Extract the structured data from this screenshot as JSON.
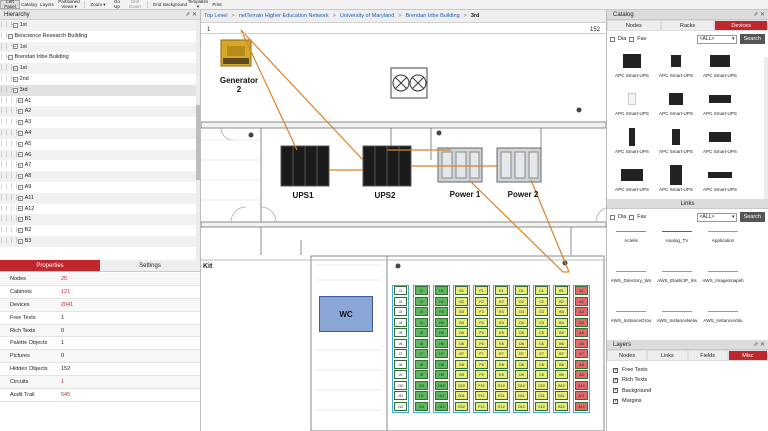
{
  "toolbar": {
    "items": [
      {
        "label": "Left Panel",
        "active": true
      },
      {
        "label": "Catalog"
      },
      {
        "label": "Layers"
      },
      {
        "label": "Partitioned Views ▾"
      },
      {
        "label": "Zoom ▾"
      },
      {
        "label": "Go Up"
      },
      {
        "label": "Drill Down",
        "disabled": true
      },
      {
        "label": "Grid"
      },
      {
        "label": "Background"
      },
      {
        "label": "Templates ▾"
      },
      {
        "label": "Print"
      }
    ]
  },
  "hierarchy": {
    "title": "Hierarchy",
    "rows": [
      {
        "guides": "│ │ ├",
        "toggle": "−",
        "label": "1st"
      },
      {
        "guides": "│ ├",
        "toggle": "−",
        "label": "Bioscience Research Building"
      },
      {
        "guides": "│ │ └",
        "toggle": "+",
        "label": "1st"
      },
      {
        "guides": "│ ├",
        "toggle": "−",
        "label": "Brendan Iribe Building"
      },
      {
        "guides": "│ │ ├",
        "toggle": "+",
        "label": "1st"
      },
      {
        "guides": "│ │ ├",
        "toggle": "+",
        "label": "2nd"
      },
      {
        "guides": "│ │ ├",
        "toggle": "−",
        "label": "3rd",
        "selected": true
      },
      {
        "guides": "│ │ │ ├",
        "toggle": "+",
        "label": "A1"
      },
      {
        "guides": "│ │ │ ├",
        "toggle": "+",
        "label": "A2"
      },
      {
        "guides": "│ │ │ ├",
        "toggle": "+",
        "label": "A3"
      },
      {
        "guides": "│ │ │ ├",
        "toggle": "+",
        "label": "A4"
      },
      {
        "guides": "│ │ │ ├",
        "toggle": "+",
        "label": "A5"
      },
      {
        "guides": "│ │ │ ├",
        "toggle": "+",
        "label": "A6"
      },
      {
        "guides": "│ │ │ ├",
        "toggle": "+",
        "label": "A7"
      },
      {
        "guides": "│ │ │ ├",
        "toggle": "+",
        "label": "A8"
      },
      {
        "guides": "│ │ │ ├",
        "toggle": "+",
        "label": "A9"
      },
      {
        "guides": "│ │ │ ├",
        "toggle": "+",
        "label": "A11"
      },
      {
        "guides": "│ │ │ ├",
        "toggle": "+",
        "label": "A12"
      },
      {
        "guides": "│ │ │ ├",
        "toggle": "+",
        "label": "B1"
      },
      {
        "guides": "│ │ │ ├",
        "toggle": "+",
        "label": "B2"
      },
      {
        "guides": "│ │ │ ├",
        "toggle": "+",
        "label": "B3"
      }
    ]
  },
  "properties": {
    "tabs": [
      "Properties",
      "Settings"
    ],
    "rows": [
      {
        "label": "Nodes",
        "value": "25",
        "red": true
      },
      {
        "label": "Cabinets",
        "value": "121",
        "red": true
      },
      {
        "label": "Devices",
        "value": "2041",
        "red": true
      },
      {
        "label": "Free Texts",
        "value": "1",
        "red": false
      },
      {
        "label": "Rich Texts",
        "value": "0",
        "red": false
      },
      {
        "label": "Palette Objects",
        "value": "1",
        "red": false
      },
      {
        "label": "Pictures",
        "value": "0",
        "red": false
      },
      {
        "label": "Hidden Objects",
        "value": "152",
        "red": false
      },
      {
        "label": "Circuits",
        "value": "1",
        "red": true
      },
      {
        "label": "Audit Trail",
        "value": "545",
        "red": true
      }
    ]
  },
  "breadcrumb": [
    "Top Level",
    "netTerrain Higher Education Network",
    "University of Maryland",
    "Brendan Iribe Building",
    "3rd"
  ],
  "canvas": {
    "page_left": "1",
    "page_right": "152",
    "generator_label": "Generator 2",
    "ups1_label": "UPS1",
    "ups2_label": "UPS2",
    "power1_label": "Power 1",
    "power2_label": "Power 2",
    "kit_label": "Kit",
    "wc_label": "WC",
    "link_color": "#d9822b",
    "rack_columns": [
      {
        "color": "#ffffff",
        "cells": [
          "J1",
          "J2",
          "J3",
          "J4",
          "J5",
          "J6",
          "J7",
          "J8",
          "J9",
          "J10",
          "J11",
          "J12"
        ]
      },
      {
        "color": "#5cb85c",
        "cells": [
          "I1",
          "I2",
          "I3",
          "I4",
          "I5",
          "I6",
          "I7",
          "I8",
          "I9",
          "I10",
          "I11",
          "I12"
        ]
      },
      {
        "color": "#5cb85c",
        "cells": [
          "H1",
          "H2",
          "H3",
          "H4",
          "H5",
          "H6",
          "H7",
          "H8",
          "H9",
          "H10",
          "H11",
          "H12"
        ]
      },
      {
        "color": "#e8ec7a",
        "cells": [
          "G1",
          "G2",
          "G3",
          "G4",
          "G5",
          "G6",
          "G7",
          "G8",
          "G9",
          "G10",
          "G11",
          "G12"
        ]
      },
      {
        "color": "#e8ec7a",
        "cells": [
          "F1",
          "F2",
          "F3",
          "F4",
          "F5",
          "F6",
          "F7",
          "F8",
          "F9",
          "F10",
          "F11",
          "F12"
        ]
      },
      {
        "color": "#e8ec7a",
        "cells": [
          "E1",
          "E2",
          "E3",
          "E4",
          "E5",
          "E6",
          "E7",
          "E8",
          "E9",
          "E10",
          "E11",
          "E12"
        ]
      },
      {
        "color": "#e8ec7a",
        "cells": [
          "D1",
          "D2",
          "D3",
          "D4",
          "D5",
          "D6",
          "D7",
          "D8",
          "D9",
          "D10",
          "D11",
          "D12"
        ]
      },
      {
        "color": "#e8ec7a",
        "cells": [
          "C1",
          "C2",
          "C3",
          "C4",
          "C5",
          "C6",
          "C7",
          "C8",
          "C9",
          "C10",
          "C11",
          "C12"
        ]
      },
      {
        "color": "#e8ec7a",
        "cells": [
          "B1",
          "B2",
          "B3",
          "B4",
          "B5",
          "B6",
          "B7",
          "B8",
          "B9",
          "B10",
          "B11",
          "B12"
        ]
      },
      {
        "color": "#e46a6a",
        "cells": [
          "A1",
          "A2",
          "A3",
          "A4",
          "A5",
          "A6",
          "A7",
          "A8",
          "A9",
          "A10",
          "A11",
          "A12"
        ]
      }
    ]
  },
  "catalog": {
    "title": "Catalog",
    "tabs": [
      "Nodes",
      "Racks",
      "Devices"
    ],
    "active_tab": "Devices",
    "filter": {
      "dia": "Dia",
      "fav": "Fav",
      "select": "<ALL>",
      "search": "Search"
    },
    "items": [
      "APC Smart-UPS",
      "APC Smart-UPS",
      "APC Smart-UPS",
      "APC Smart-UPS",
      "APC Smart-UPS",
      "APC Smart-UPS",
      "APC Smart-UPS",
      "APC Smart-UPS",
      "APC Smart-UPS",
      "APC Smart-UPS",
      "APC Smart-UPS",
      "APC Smart-UPS"
    ]
  },
  "links": {
    "title": "Links",
    "filter": {
      "dia": "Dia",
      "fav": "Fav",
      "select": "<ALL>",
      "search": "Search"
    },
    "items": [
      {
        "label": "Actelis",
        "color": "#888888"
      },
      {
        "label": "Analog_TV",
        "color": "#8e3fa8"
      },
      {
        "label": "Application",
        "color": "#4fb6d6"
      },
      {
        "label": "AWS_Directory_Wo",
        "color": "#999999"
      },
      {
        "label": "AWS_ElasticIP_Ins",
        "color": "#999999"
      },
      {
        "label": "AWS_ImageSnapsh",
        "color": "#999999"
      },
      {
        "label": "AWS_InstanceGrou",
        "color": "#999999"
      },
      {
        "label": "AWS_InstanceNetw",
        "color": "#999999"
      },
      {
        "label": "AWS_InstanceVolu",
        "color": "#999999"
      }
    ]
  },
  "layers": {
    "title": "Layers",
    "tabs": [
      "Nodes",
      "Links",
      "Fields",
      "Misc"
    ],
    "active_tab": "Misc",
    "items": [
      {
        "label": "Free Texts",
        "checked": true
      },
      {
        "label": "Rich Texts",
        "checked": true
      },
      {
        "label": "Background",
        "checked": true
      },
      {
        "label": "Margins",
        "checked": true
      }
    ]
  },
  "colors": {
    "accent": "#c0272d",
    "link": "#d9822b"
  }
}
